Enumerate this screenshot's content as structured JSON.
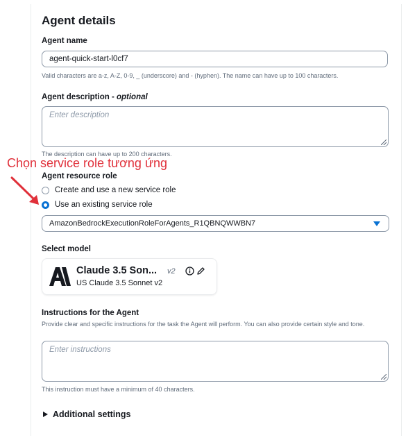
{
  "page": {
    "title": "Agent details"
  },
  "agent_name": {
    "label": "Agent name",
    "value": "agent-quick-start-l0cf7",
    "hint": "Valid characters are a-z, A-Z, 0-9, _ (underscore) and - (hyphen). The name can have up to 100 characters."
  },
  "agent_description": {
    "label": "Agent description - ",
    "label_optional": "optional",
    "placeholder": "Enter description",
    "hint": "The description can have up to 200 characters."
  },
  "annotation": {
    "text": "Chọn service role tương ứng"
  },
  "resource_role": {
    "label": "Agent resource role",
    "options": [
      {
        "label": "Create and use a new service role",
        "selected": false
      },
      {
        "label": "Use an existing service role",
        "selected": true
      }
    ],
    "selected_role": "AmazonBedrockExecutionRoleForAgents_R1QBNQWWBN7"
  },
  "model": {
    "label": "Select model",
    "name": "Claude 3.5 Son...",
    "version": "v2",
    "subtitle": "US Claude 3.5 Sonnet v2",
    "logo_text": "A\\"
  },
  "instructions": {
    "label": "Instructions for the Agent",
    "description": "Provide clear and specific instructions for the task the Agent will perform. You can also provide certain style and tone.",
    "placeholder": "Enter instructions",
    "hint": "This instruction must have a minimum of 40 characters."
  },
  "additional_settings": {
    "label": "Additional settings"
  },
  "colors": {
    "accent": "#0972d3",
    "annotation": "#e0303a",
    "text": "#16191f",
    "muted": "#5f6b7a"
  }
}
